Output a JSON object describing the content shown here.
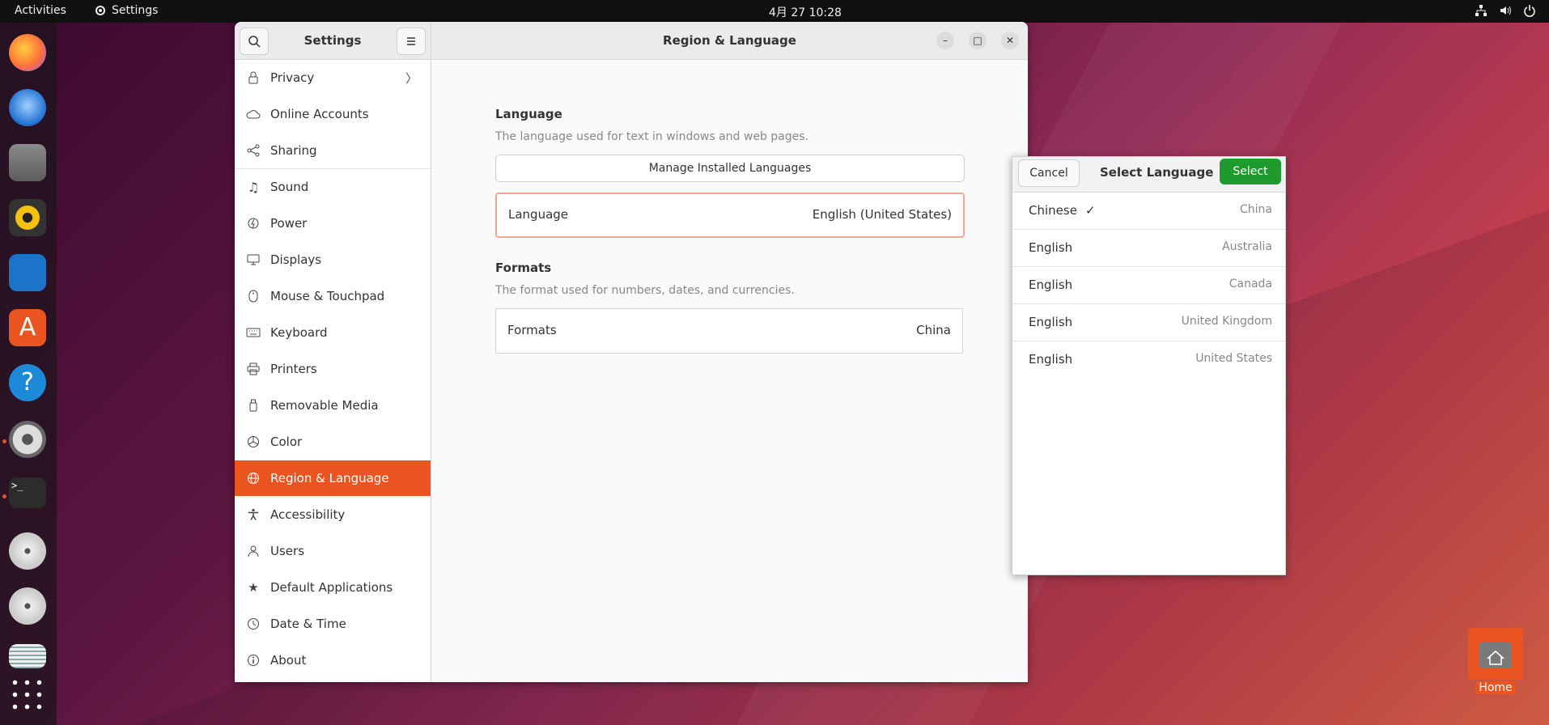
{
  "topbar": {
    "activities": "Activities",
    "app_name": "Settings",
    "clock": "4月 27  10:28"
  },
  "dock": {
    "items": [
      "firefox-icon",
      "thunderbird-icon",
      "files-icon",
      "rhythmbox-icon",
      "writer-icon",
      "software-icon",
      "help-icon",
      "settings-icon",
      "terminal-icon",
      "disc-icon",
      "disc-icon",
      "scanner-icon",
      "app-grid-icon"
    ]
  },
  "window": {
    "sidebar_title": "Settings",
    "main_title": "Region & Language"
  },
  "sidebar": {
    "items": [
      {
        "label": "Privacy",
        "icon": "lock-icon"
      },
      {
        "label": "Online Accounts",
        "icon": "cloud-icon"
      },
      {
        "label": "Sharing",
        "icon": "share-icon"
      },
      {
        "label": "Sound",
        "icon": "music-note-icon"
      },
      {
        "label": "Power",
        "icon": "power-icon"
      },
      {
        "label": "Displays",
        "icon": "display-icon"
      },
      {
        "label": "Mouse & Touchpad",
        "icon": "mouse-icon"
      },
      {
        "label": "Keyboard",
        "icon": "keyboard-icon"
      },
      {
        "label": "Printers",
        "icon": "printer-icon"
      },
      {
        "label": "Removable Media",
        "icon": "usb-icon"
      },
      {
        "label": "Color",
        "icon": "color-icon"
      },
      {
        "label": "Region & Language",
        "icon": "globe-icon",
        "selected": true
      },
      {
        "label": "Accessibility",
        "icon": "accessibility-icon"
      },
      {
        "label": "Users",
        "icon": "users-icon"
      },
      {
        "label": "Default Applications",
        "icon": "star-icon"
      },
      {
        "label": "Date & Time",
        "icon": "clock-icon"
      },
      {
        "label": "About",
        "icon": "info-icon"
      }
    ]
  },
  "main": {
    "language_title": "Language",
    "language_desc": "The language used for text in windows and web pages.",
    "manage_button": "Manage Installed Languages",
    "language_row_label": "Language",
    "language_row_value": "English (United States)",
    "formats_title": "Formats",
    "formats_desc": "The format used for numbers, dates, and currencies.",
    "formats_row_label": "Formats",
    "formats_row_value": "China"
  },
  "dialog": {
    "cancel": "Cancel",
    "title": "Select Language",
    "select": "Select",
    "languages": [
      {
        "name": "Chinese",
        "country": "China",
        "checked": true,
        "check": "✓"
      },
      {
        "name": "English",
        "country": "Australia"
      },
      {
        "name": "English",
        "country": "Canada"
      },
      {
        "name": "English",
        "country": "United Kingdom"
      },
      {
        "name": "English",
        "country": "United States"
      }
    ]
  },
  "desktop": {
    "home_label": "Home"
  },
  "colors": {
    "accent": "#e95420",
    "select_green": "#1f9b2e"
  }
}
